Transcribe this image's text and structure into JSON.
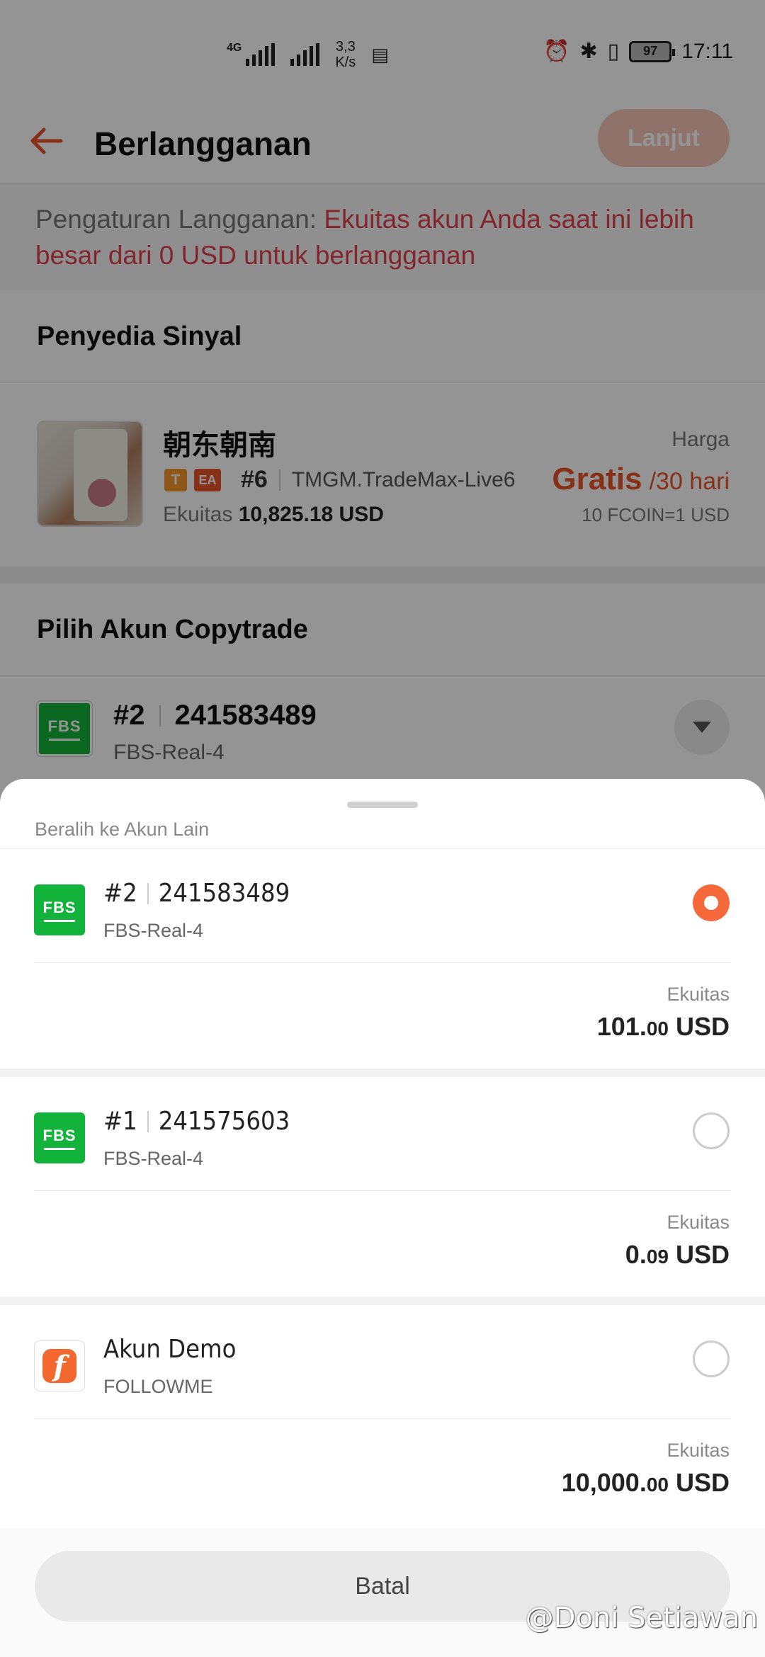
{
  "status_bar": {
    "network": "4G",
    "speed_value": "3,3",
    "speed_unit": "K/s",
    "battery": "97",
    "time": "17:11"
  },
  "header": {
    "title": "Berlangganan",
    "next_label": "Lanjut"
  },
  "notice": {
    "label": "Pengaturan Langganan: ",
    "message": "Ekuitas akun Anda saat ini lebih besar dari 0 USD untuk berlangganan"
  },
  "provider_section": {
    "heading": "Penyedia Sinyal",
    "name": "朝东朝南",
    "tag_t": "T",
    "tag_ea": "EA",
    "rank": "#6",
    "server": "TMGM.TradeMax-Live6",
    "equity_label": "Ekuitas",
    "equity_value": "10,825.18 USD",
    "price_label": "Harga",
    "price_value": "Gratis",
    "price_period": "/30 hari",
    "rate": "10 FCOIN=1 USD"
  },
  "copytrade_section": {
    "heading": "Pilih Akun Copytrade",
    "selected": {
      "logo": "FBS",
      "index": "#2",
      "number": "241583489",
      "server": "FBS-Real-4"
    }
  },
  "sheet": {
    "title": "Beralih ke Akun Lain",
    "accounts": [
      {
        "logo": "FBS",
        "index": "#2",
        "number": "241583489",
        "server": "FBS-Real-4",
        "equity_label": "Ekuitas",
        "equity_int": "101.",
        "equity_dec": "00",
        "currency": "USD",
        "selected": true
      },
      {
        "logo": "FBS",
        "index": "#1",
        "number": "241575603",
        "server": "FBS-Real-4",
        "equity_label": "Ekuitas",
        "equity_int": "0.",
        "equity_dec": "09",
        "currency": "USD",
        "selected": false
      },
      {
        "logo": "f",
        "name": "Akun Demo",
        "server": "FOLLOWME",
        "equity_label": "Ekuitas",
        "equity_int": "10,000.",
        "equity_dec": "00",
        "currency": "USD",
        "selected": false
      }
    ],
    "cancel_label": "Batal"
  },
  "watermark": "@Doni Setiawan",
  "colors": {
    "accent": "#e8542a",
    "warning": "#e0414f",
    "fbs_green": "#12b33a",
    "radio_on": "#f5683a"
  }
}
